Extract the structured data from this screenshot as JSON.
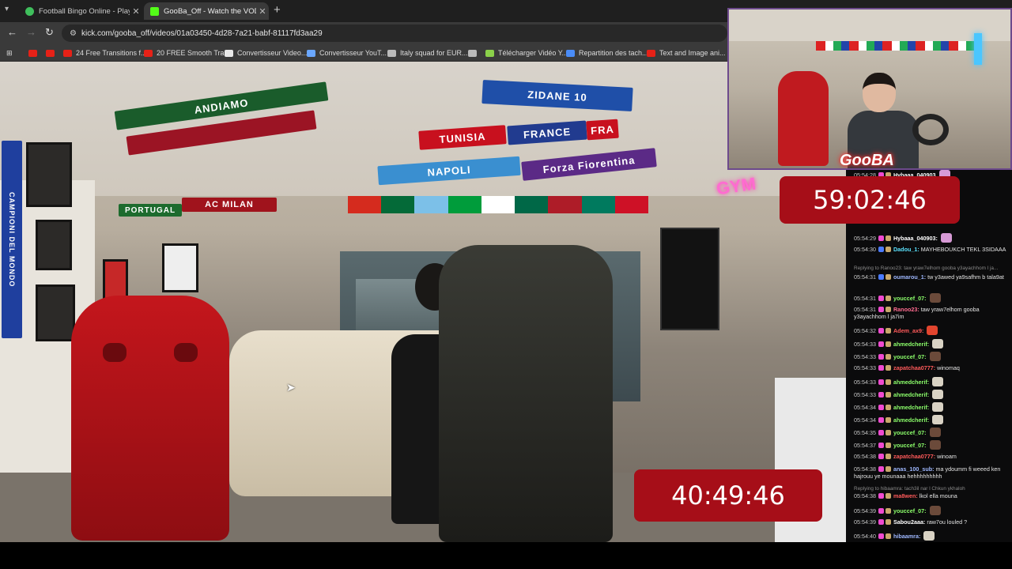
{
  "browser": {
    "tabs": [
      {
        "title": "Football Bingo Online - Play No",
        "close": "✕",
        "favicon_color": "#3fbf5c"
      },
      {
        "title": "GooBa_Off - Watch the VOD on",
        "close": "✕",
        "favicon_color": "#53fc18"
      }
    ],
    "new_tab": "+",
    "url": "kick.com/gooba_off/videos/01a03450-4d28-7a21-babf-81117fd3aa29",
    "bookmarks": [
      {
        "label": "",
        "color": "#e62117"
      },
      {
        "label": "",
        "color": "#e62117"
      },
      {
        "label": "24 Free Transitions f...",
        "color": "#e62117"
      },
      {
        "label": "20 FREE Smooth Tra...",
        "color": "#e62117"
      },
      {
        "label": "Convertisseur Video...",
        "color": "#e8e8e8"
      },
      {
        "label": "Convertisseur YouT...",
        "color": "#6aa7ff"
      },
      {
        "label": "Italy squad for EUR...",
        "color": "#bbbbbb"
      },
      {
        "label": "",
        "color": "#bbbbbb"
      },
      {
        "label": "Télécharger Vidéo Y...",
        "color": "#8bd14a"
      },
      {
        "label": "Repartition des tach...",
        "color": "#4a8cf7"
      },
      {
        "label": "Text and Image ani...",
        "color": "#e62117"
      }
    ]
  },
  "video": {
    "scarves": {
      "andiamo": "ANDIAMO",
      "zidane": "ZIDANE 10",
      "tunisia": "TUNISIA",
      "france": "FRANCE",
      "fra": "FRA",
      "napoli": "NAPOLI",
      "fiorentina": "Forza Fiorentina",
      "acmilan": "AC MILAN",
      "portugal": "PORTUGAL",
      "campioni": "CAMPIONI DEL MONDO"
    },
    "timer_bottom": "40:49:46",
    "neon_sign": "GYM"
  },
  "webcam": {
    "logo": "GooBA"
  },
  "timer_top": "59:02:46",
  "chat": [
    {
      "ts": "05:54:28",
      "user": "Hybaaa_040903",
      "color": "#ffffff",
      "msg": "",
      "emote": "#d79ad6",
      "badges": [
        "#ef4ad0",
        "#c9a86b"
      ]
    },
    {
      "ts": "05:54:29",
      "user": "Hybaaa_040903:",
      "color": "#ffffff",
      "msg": "",
      "emote": "#d79ad6",
      "badges": [
        "#ef4ad0",
        "#c9a86b"
      ]
    },
    {
      "ts": "05:54:30",
      "user": "Dadou_1:",
      "color": "#5be3ff",
      "msg": "MAYHEBOUKCH TEKL 3SIDAAA",
      "emote": "",
      "badges": [
        "#4b7bff",
        "#c9a86b"
      ]
    },
    {
      "reply": "Replying to Ranoo23: taw yraw7elhom gooba y3ayachhom l ja..."
    },
    {
      "ts": "05:54:31",
      "user": "oumarou_1:",
      "color": "#9fb8ff",
      "msg": "tw y3awed ya9safhm b tala9at",
      "emote": "",
      "badges": [
        "#4b7bff",
        "#c9a86b"
      ]
    },
    {
      "ts": "05:54:31",
      "user": "youccef_07:",
      "color": "#8cff6b",
      "msg": "",
      "emote": "#6b4a3a",
      "badges": [
        "#ef4ad0",
        "#c9a86b"
      ]
    },
    {
      "ts": "05:54:31",
      "user": "Ranoo23:",
      "color": "#ff6b8f",
      "msg": "taw yraw7elhom gooba y3ayachhom l ja7im",
      "emote": "",
      "badges": [
        "#ef4ad0",
        "#c9a86b"
      ]
    },
    {
      "ts": "05:54:32",
      "user": "Adem_ax9:",
      "color": "#ff5a5a",
      "msg": "",
      "emote": "#e2452e",
      "badges": [
        "#ef4ad0",
        "#c9a86b"
      ]
    },
    {
      "ts": "05:54:33",
      "user": "ahmedcherif:",
      "color": "#8cff6b",
      "msg": "",
      "emote": "#d9d2c4",
      "badges": [
        "#ef4ad0",
        "#c9a86b"
      ]
    },
    {
      "ts": "05:54:33",
      "user": "youccef_07:",
      "color": "#8cff6b",
      "msg": "",
      "emote": "#6b4a3a",
      "badges": [
        "#ef4ad0",
        "#c9a86b"
      ]
    },
    {
      "ts": "05:54:33",
      "user": "zapatchaa0777:",
      "color": "#ff5a5a",
      "msg": "winomaq",
      "emote": "",
      "badges": [
        "#ef4ad0",
        "#c9a86b"
      ]
    },
    {
      "ts": "05:54:33",
      "user": "ahmedcherif:",
      "color": "#8cff6b",
      "msg": "",
      "emote": "#d9d2c4",
      "badges": [
        "#ef4ad0",
        "#c9a86b"
      ]
    },
    {
      "ts": "05:54:33",
      "user": "ahmedcherif:",
      "color": "#8cff6b",
      "msg": "",
      "emote": "#d9d2c4",
      "badges": [
        "#ef4ad0",
        "#c9a86b"
      ]
    },
    {
      "ts": "05:54:34",
      "user": "ahmedcherif:",
      "color": "#8cff6b",
      "msg": "",
      "emote": "#d9d2c4",
      "badges": [
        "#ef4ad0",
        "#c9a86b"
      ]
    },
    {
      "ts": "05:54:34",
      "user": "ahmedcherif:",
      "color": "#8cff6b",
      "msg": "",
      "emote": "#d9d2c4",
      "badges": [
        "#ef4ad0",
        "#c9a86b"
      ]
    },
    {
      "ts": "05:54:35",
      "user": "youccef_07:",
      "color": "#8cff6b",
      "msg": "",
      "emote": "#6b4a3a",
      "badges": [
        "#ef4ad0",
        "#c9a86b"
      ]
    },
    {
      "ts": "05:54:37",
      "user": "youccef_07:",
      "color": "#8cff6b",
      "msg": "",
      "emote": "#6b4a3a",
      "badges": [
        "#ef4ad0",
        "#c9a86b"
      ]
    },
    {
      "ts": "05:54:38",
      "user": "zapatchaa0777:",
      "color": "#ff5a5a",
      "msg": "winoam",
      "emote": "",
      "badges": [
        "#ef4ad0",
        "#c9a86b"
      ]
    },
    {
      "ts": "05:54:38",
      "user": "anas_100_sub:",
      "color": "#9fb8ff",
      "msg": "ma ydoumm fi weeed ken hajrouu ye mounaaa hehhhhhhhhh",
      "emote": "",
      "badges": [
        "#ef4ad0",
        "#c9a86b"
      ]
    },
    {
      "reply": "Replying to hibaamra: tach3il nar l Chkun ykhaloh"
    },
    {
      "ts": "05:54:38",
      "user": "ma8wen:",
      "color": "#ff5a5a",
      "msg": "lkol ella mouna",
      "emote": "",
      "badges": [
        "#ef4ad0",
        "#c9a86b"
      ]
    },
    {
      "ts": "05:54:39",
      "user": "youccef_07:",
      "color": "#8cff6b",
      "msg": "",
      "emote": "#6b4a3a",
      "badges": [
        "#ef4ad0",
        "#c9a86b"
      ]
    },
    {
      "ts": "05:54:39",
      "user": "Sabou2aaa:",
      "color": "#ffffff",
      "msg": "raw7ou louled ?",
      "emote": "",
      "badges": [
        "#ef4ad0",
        "#c9a86b"
      ]
    },
    {
      "ts": "05:54:40",
      "user": "hibaamra:",
      "color": "#9fb8ff",
      "msg": "",
      "emote": "#d9d2c4",
      "badges": [
        "#ef4ad0",
        "#c9a86b"
      ]
    }
  ]
}
